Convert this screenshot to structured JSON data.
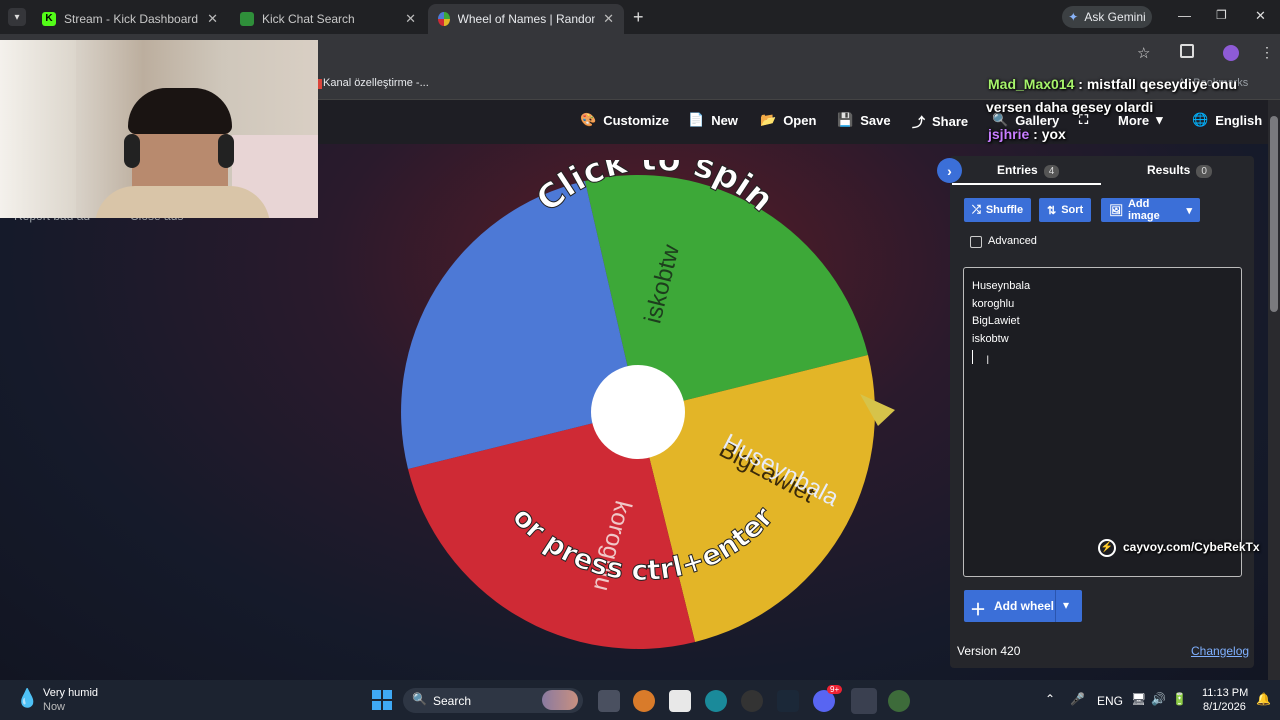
{
  "browser": {
    "tabs": [
      {
        "title": "Stream - Kick Dashboard"
      },
      {
        "title": "Kick Chat Search"
      },
      {
        "title": "Wheel of Names | Random nan"
      }
    ],
    "ask_gemini": "Ask Gemini",
    "bookmark_item": "Kanal özelleştirme -...",
    "bookmarks_right": "All Bookmarks"
  },
  "site_header": {
    "customize": "Customize",
    "new": "New",
    "open": "Open",
    "save": "Save",
    "share": "Share",
    "gallery": "Gallery",
    "more": "More",
    "language": "English"
  },
  "ads_bar": {
    "report": "Report bad ad",
    "close": "Close ads"
  },
  "chat": [
    {
      "user": "Mad_Max014",
      "message": " : mistfall qeseydiye onu",
      "color": "#a6f36b"
    },
    {
      "user": "",
      "message": "versen daha gesey olardi",
      "color": "#ffffff"
    },
    {
      "user": "jsjhrie",
      "message": " : yox",
      "color": "#c77dff"
    }
  ],
  "wheel": {
    "segments": [
      {
        "label": "iskobtw",
        "color": "#3da838"
      },
      {
        "label": "BigLawiet",
        "color": "#e3b527"
      },
      {
        "label": "koroghlu",
        "color": "#cf2a35"
      },
      {
        "label": "Huseynbala",
        "color": "#4d79d6"
      }
    ],
    "click_text": "Click to spin",
    "press_text": "or press ctrl+enter"
  },
  "panel": {
    "entries_tab": "Entries",
    "entries_count": "4",
    "results_tab": "Results",
    "results_count": "0",
    "shuffle": "Shuffle",
    "sort": "Sort",
    "add_image": "Add image",
    "advanced": "Advanced",
    "entries": [
      "Huseynbala",
      "koroghlu",
      "BigLawiet",
      "iskobtw"
    ],
    "watermark": "cayvoy.com/CybeRekTx",
    "add_wheel": "Add wheel",
    "version": "Version 420",
    "changelog": "Changelog"
  },
  "taskbar": {
    "weather_title": "Very humid",
    "weather_sub": "Now",
    "search": "Search",
    "language": "ENG",
    "time": "11:13 PM",
    "date": "8/1/2026",
    "discord_badge": "9+"
  },
  "colors": {
    "accent_blue": "#3b6fd8",
    "panel_bg": "#25262b",
    "pointer": "#d6c34a"
  }
}
